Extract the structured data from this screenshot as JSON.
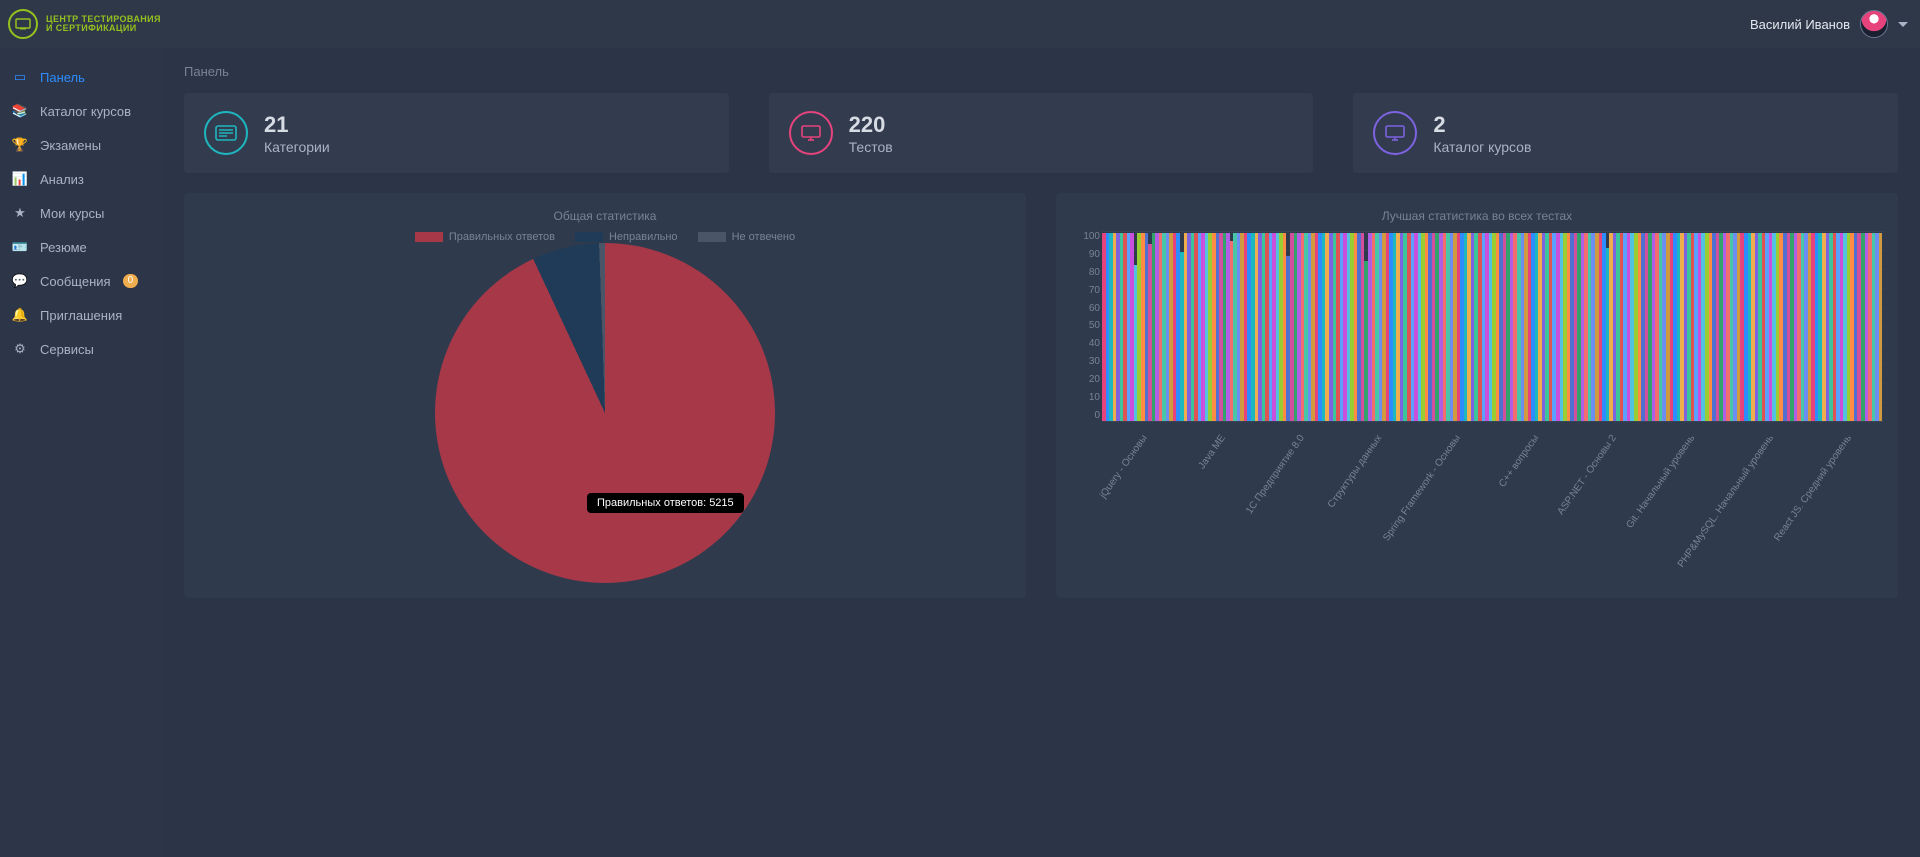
{
  "header": {
    "logo_line1": "ЦЕНТР ТЕСТИРОВАНИЯ",
    "logo_line2": "И СЕРТИФИКАЦИИ",
    "user_name": "Василий Иванов"
  },
  "sidebar": {
    "items": [
      {
        "label": "Панель",
        "icon": "▭"
      },
      {
        "label": "Каталог курсов",
        "icon": "📚"
      },
      {
        "label": "Экзамены",
        "icon": "🏆"
      },
      {
        "label": "Анализ",
        "icon": "📊"
      },
      {
        "label": "Мои курсы",
        "icon": "★"
      },
      {
        "label": "Резюме",
        "icon": "🪪"
      },
      {
        "label": "Сообщения",
        "icon": "💬",
        "badge": "0"
      },
      {
        "label": "Приглашения",
        "icon": "🔔"
      },
      {
        "label": "Сервисы",
        "icon": "⚙"
      }
    ]
  },
  "breadcrumb": "Панель",
  "cards": [
    {
      "value": "21",
      "label": "Категории"
    },
    {
      "value": "220",
      "label": "Тестов"
    },
    {
      "value": "2",
      "label": "Каталог курсов"
    }
  ],
  "pie": {
    "title": "Общая статистика",
    "legend": [
      "Правильных ответов",
      "Неправильно",
      "Не отвечено"
    ],
    "colors": [
      "#a73848",
      "#1f3b57",
      "#4a5568"
    ],
    "tooltip": "Правильных ответов: 5215"
  },
  "bar": {
    "title": "Лучшая статистика во всех тестах",
    "ymax": 100,
    "yticks": [
      100,
      90,
      80,
      70,
      60,
      50,
      40,
      30,
      20,
      10,
      0
    ],
    "xticks_visible": [
      "jQuery - Основы",
      "Java ME",
      "1С Предприятие 8.0",
      "Структуры данных",
      "Spring Framework - Основы",
      "C++ вопросы",
      "ASP.NET - Основы 2",
      "Git. Начальный уровень",
      "PHP&MySQL. Начальный уровень",
      "React JS. Средний уровень"
    ]
  },
  "chart_data": [
    {
      "type": "pie",
      "title": "Общая статистика",
      "series": [
        {
          "name": "Правильных ответов",
          "value": 5215,
          "pct": 93
        },
        {
          "name": "Неправильно",
          "value": 356,
          "pct": 6
        },
        {
          "name": "Не отвечено",
          "value": 40,
          "pct": 1
        }
      ]
    },
    {
      "type": "bar",
      "title": "Лучшая статистика во всех тестах",
      "ylabel": "",
      "ylim": [
        0,
        100
      ],
      "note": "≈220 bars; x-axis shows every ~22nd label rotated",
      "x_labels_sample": [
        "jQuery - Основы",
        "Java ME",
        "1С Предприятие 8.0",
        "Структуры данных",
        "Spring Framework - Основы",
        "C++ вопросы",
        "ASP.NET - Основы 2",
        "Git. Начальный уровень",
        "PHP&MySQL. Начальный уровень",
        "React JS. Средний уровень"
      ],
      "values": [
        99,
        99,
        99,
        99,
        99,
        99,
        99,
        99,
        99,
        82,
        99,
        99,
        99,
        93,
        99,
        99,
        99,
        99,
        99,
        99,
        99,
        99,
        89,
        99,
        99,
        99,
        99,
        99,
        99,
        99,
        99,
        99,
        99,
        99,
        99,
        99,
        95,
        99,
        99,
        99,
        99,
        99,
        99,
        99,
        99,
        99,
        99,
        99,
        99,
        99,
        99,
        99,
        87,
        99,
        99,
        99,
        99,
        99,
        99,
        99,
        99,
        99,
        99,
        99,
        99,
        99,
        99,
        99,
        99,
        99,
        99,
        99,
        99,
        99,
        84,
        99,
        99,
        99,
        99,
        99,
        99,
        99,
        99,
        99,
        99,
        99,
        99,
        99,
        99,
        99,
        99,
        99,
        99,
        99,
        99,
        99,
        99,
        99,
        99,
        99,
        99,
        99,
        99,
        99,
        99,
        99,
        99,
        99,
        99,
        99,
        99,
        99,
        99,
        99,
        99,
        99,
        99,
        99,
        99,
        99,
        99,
        99,
        99,
        99,
        99,
        99,
        99,
        99,
        99,
        99,
        99,
        99,
        99,
        99,
        99,
        99,
        99,
        99,
        99,
        99,
        99,
        99,
        91,
        99,
        99,
        99,
        99,
        99,
        99,
        99,
        99,
        99,
        99,
        99,
        99,
        99,
        99,
        99,
        99,
        99,
        99,
        99,
        99,
        99,
        99,
        99,
        99,
        99,
        99,
        99,
        99,
        99,
        99,
        99,
        99,
        99,
        99,
        99,
        99,
        99,
        99,
        99,
        99,
        99,
        99,
        99,
        99,
        99,
        99,
        99,
        99,
        99,
        99,
        99,
        99,
        99,
        99,
        99,
        99,
        99,
        99,
        99,
        99,
        99,
        99,
        99,
        99,
        99,
        99,
        99,
        99,
        99,
        99,
        99,
        99,
        99,
        99,
        99,
        99,
        99
      ]
    }
  ]
}
